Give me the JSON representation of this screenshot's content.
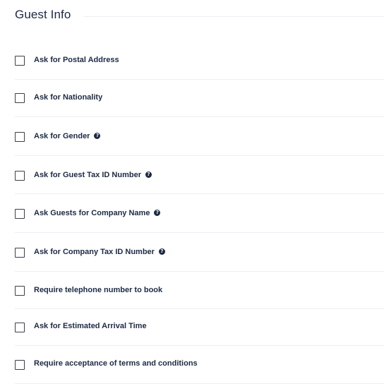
{
  "section": {
    "title": "Guest Info"
  },
  "options": [
    {
      "label": "Ask for Postal Address",
      "checked": false,
      "help": false
    },
    {
      "label": "Ask for Nationality",
      "checked": false,
      "help": false
    },
    {
      "label": "Ask for Gender",
      "checked": false,
      "help": true
    },
    {
      "label": "Ask for Guest Tax ID Number",
      "checked": false,
      "help": true
    },
    {
      "label": "Ask Guests for Company Name",
      "checked": false,
      "help": true
    },
    {
      "label": "Ask for Company Tax ID Number",
      "checked": false,
      "help": true
    },
    {
      "label": "Require telephone number to book",
      "checked": false,
      "help": false
    },
    {
      "label": "Ask for Estimated Arrival Time",
      "checked": false,
      "help": false
    },
    {
      "label": "Require acceptance of terms and conditions",
      "checked": false,
      "help": false
    }
  ],
  "icons": {
    "help": "question-circle-icon"
  },
  "colors": {
    "text": "#1c2a44",
    "divider": "#eceef2",
    "checkbox_border": "#3a3f4a"
  }
}
